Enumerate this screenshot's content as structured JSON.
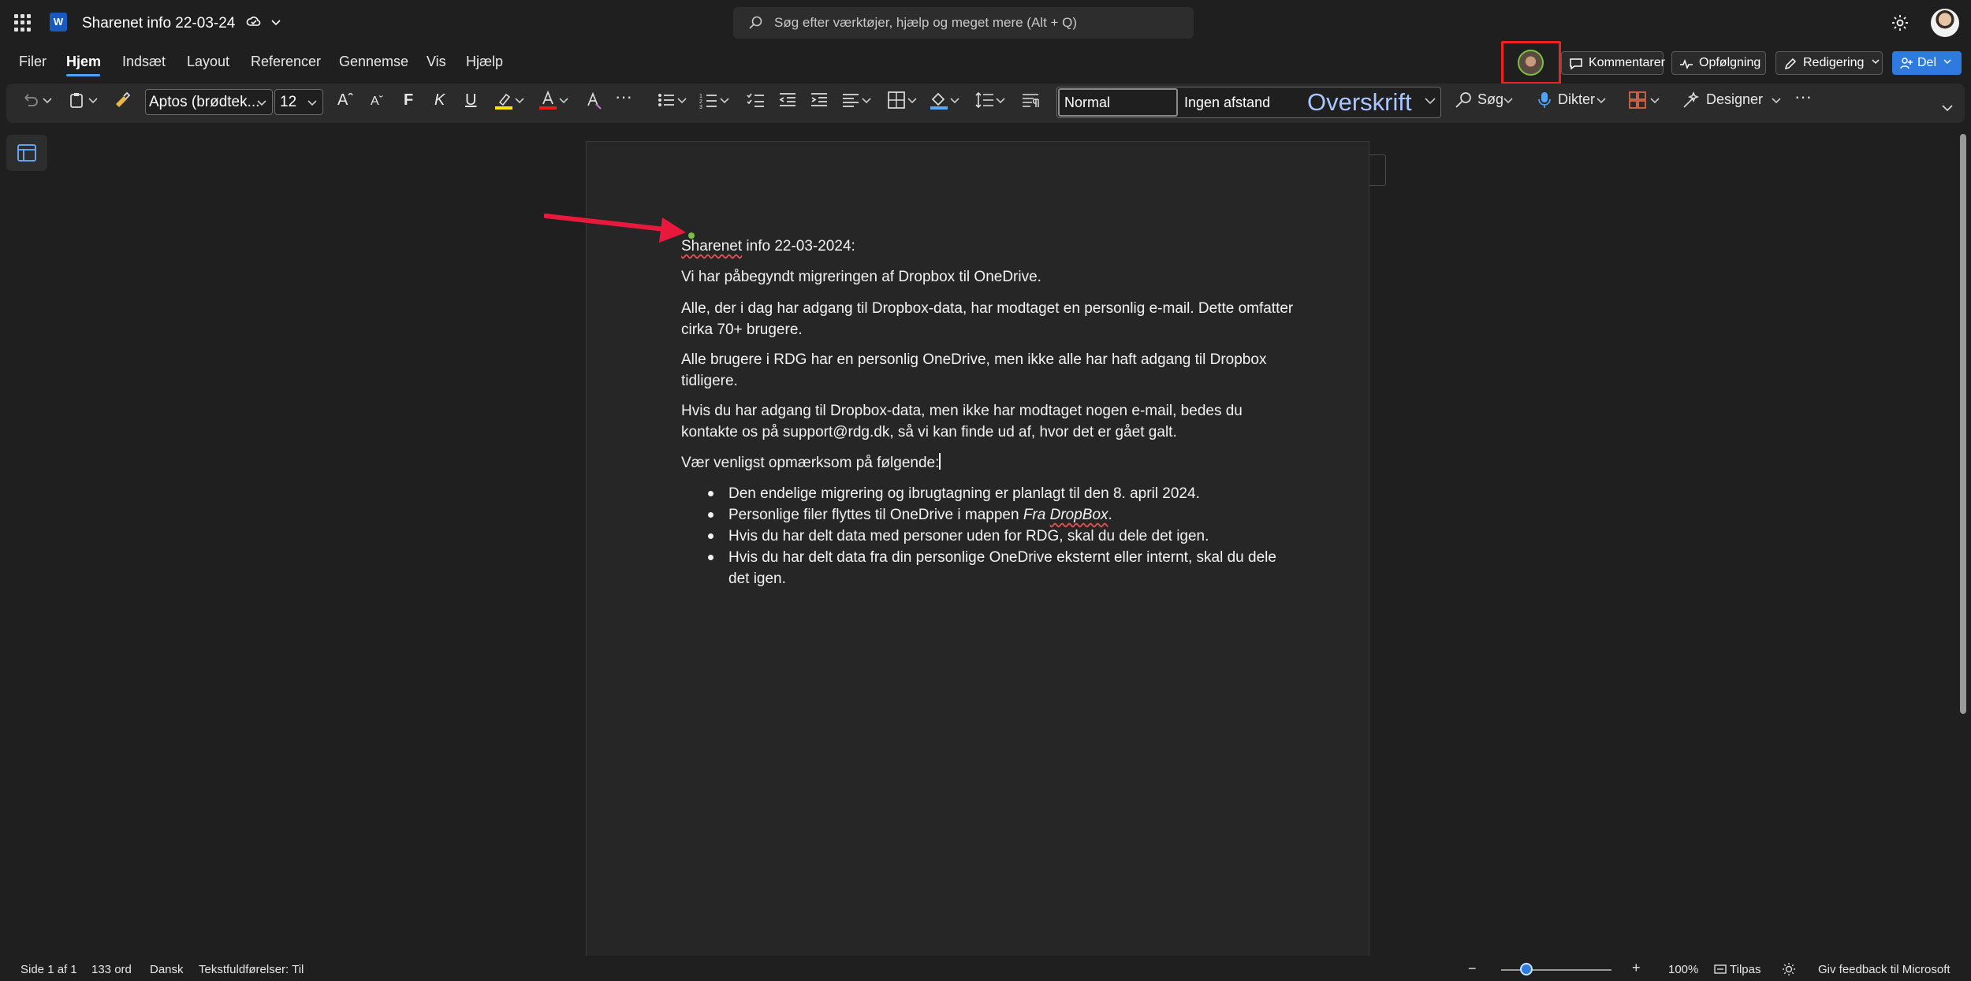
{
  "titlebar": {
    "doc_title": "Sharenet info 22-03-24",
    "search_placeholder": "Søg efter værktøjer, hjælp og meget mere (Alt + Q)"
  },
  "menu": {
    "items": [
      "Filer",
      "Hjem",
      "Indsæt",
      "Layout",
      "Referencer",
      "Gennemse",
      "Vis",
      "Hjælp"
    ],
    "active": "Hjem"
  },
  "actions": {
    "comments": "Kommentarer",
    "followup": "Opfølgning",
    "editing": "Redigering",
    "share": "Del"
  },
  "ribbon": {
    "font_name": "Aptos (brødtek...",
    "font_size": "12",
    "bold": "F",
    "italic": "K",
    "underline": "U",
    "styles": {
      "normal": "Normal",
      "no_spacing": "Ingen afstand",
      "heading": "Overskrift"
    },
    "search_label": "Søg",
    "dictate_label": "Dikter",
    "designer_label": "Designer",
    "more": "···"
  },
  "document": {
    "title_word": "Sharenet",
    "title_rest": " info 22-03-2024:",
    "paragraphs": [
      "Vi har påbegyndt migreringen af Dropbox til OneDrive.",
      "Alle, der i dag har adgang til Dropbox-data, har modtaget en personlig e-mail. Dette omfatter cirka 70+ brugere.",
      "Alle brugere i RDG har en personlig OneDrive, men ikke alle har haft adgang til Dropbox tidligere.",
      "Hvis du har adgang til Dropbox-data, men ikke har modtaget nogen e-mail, bedes du kontakte os på support@rdg.dk, så vi kan finde ud af, hvor det er gået galt.",
      "Vær venligst opmærksom på følgende:"
    ],
    "bullets": {
      "b1": "Den endelige migrering og ibrugtagning er planlagt til den 8. april 2024.",
      "b2_prefix": "Personlige filer flyttes til OneDrive i mappen ",
      "b2_italic": "Fra",
      "b2_italic2": "DropBox",
      "b2_suffix": ".",
      "b3": "Hvis du har delt data med personer uden for RDG, skal du dele det igen.",
      "b4": "Hvis du har delt data fra din personlige OneDrive eksternt eller internt, skal du dele det igen."
    }
  },
  "statusbar": {
    "page": "Side 1 af 1",
    "words": "133 ord",
    "language": "Dansk",
    "predictions": "Tekstfuldførelser: Til",
    "zoom_minus": "−",
    "zoom_plus": "+",
    "zoom": "100%",
    "fit": "Tilpas",
    "feedback": "Giv feedback til Microsoft",
    "zoom_level_percent": 100
  },
  "colors": {
    "accent": "#2f7adf",
    "annotation": "#e8193c",
    "highlight_box": "#e22222"
  }
}
